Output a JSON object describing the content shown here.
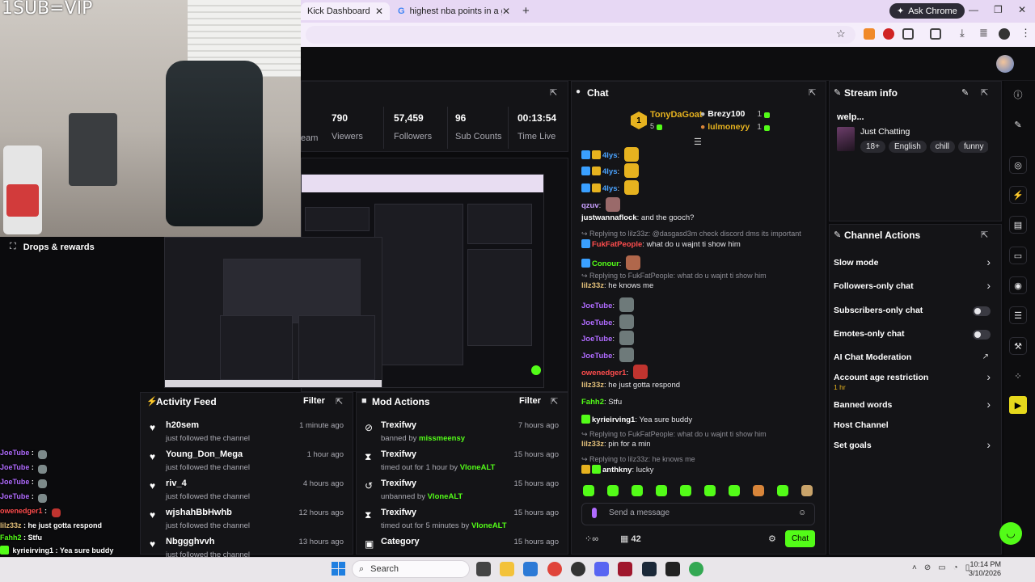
{
  "browser": {
    "tabs": [
      {
        "label": "Kick Dashboard",
        "active": true
      },
      {
        "label": "highest nba points in a game b",
        "active": false
      }
    ],
    "new_tab": "+",
    "ask_chrome": "Ask Chrome",
    "window_controls": [
      "—",
      "❐",
      "✕"
    ]
  },
  "webcam": {
    "overlay_text": "1SUB=VIP"
  },
  "stats": [
    {
      "value": "790",
      "label": "Viewers"
    },
    {
      "value": "57,459",
      "label": "Followers"
    },
    {
      "value": "96",
      "label": "Sub Counts"
    },
    {
      "value": "00:13:54",
      "label": "Time Live"
    }
  ],
  "stats_partial_label": "eam",
  "drops": {
    "label": "Drops & rewards"
  },
  "activity_feed": {
    "title": "Activity Feed",
    "filter": "Filter",
    "items": [
      {
        "name": "h20sem",
        "sub": "just followed the channel",
        "time": "1 minute ago"
      },
      {
        "name": "Young_Don_Mega",
        "sub": "just followed the channel",
        "time": "1 hour ago"
      },
      {
        "name": "riv_4",
        "sub": "just followed the channel",
        "time": "4 hours ago"
      },
      {
        "name": "wjshahBbHwhb",
        "sub": "just followed the channel",
        "time": "12 hours ago"
      },
      {
        "name": "Nbggghvvh",
        "sub": "just followed the channel",
        "time": "13 hours ago"
      }
    ]
  },
  "mod_actions": {
    "title": "Mod Actions",
    "filter": "Filter",
    "items": [
      {
        "name": "Trexifwy",
        "prefix": "banned by ",
        "by": "missmeensy",
        "time": "7 hours ago",
        "icon": "ban-icon"
      },
      {
        "name": "Trexifwy",
        "prefix": "timed out for 1 hour by ",
        "by": "VloneALT",
        "time": "15 hours ago",
        "icon": "hourglass-icon"
      },
      {
        "name": "Trexifwy",
        "prefix": "unbanned by ",
        "by": "VloneALT",
        "time": "15 hours ago",
        "icon": "undo-icon"
      },
      {
        "name": "Trexifwy",
        "prefix": "timed out for 5 minutes by ",
        "by": "VloneALT",
        "time": "15 hours ago",
        "icon": "hourglass-icon"
      },
      {
        "name": "Category",
        "prefix": "",
        "by": "",
        "time": "15 hours ago",
        "icon": "category-icon"
      }
    ]
  },
  "chat": {
    "title": "Chat",
    "top_gifter": {
      "name": "TonyDaGoat",
      "count": "5",
      "rank": "1"
    },
    "gifters": [
      {
        "name": "Brezy100",
        "count": "1"
      },
      {
        "name": "lulmoneyy",
        "count": "1"
      }
    ],
    "messages": [
      {
        "type": "msg",
        "user": "4lys",
        "color": "#4aa3ff",
        "text": ""
      },
      {
        "type": "msg",
        "user": "4lys",
        "color": "#4aa3ff",
        "text": ""
      },
      {
        "type": "msg",
        "user": "4lys",
        "color": "#4aa3ff",
        "text": ""
      },
      {
        "type": "msg",
        "user": "qzuv",
        "color": "#c9a0ff",
        "text": ""
      },
      {
        "type": "msg",
        "user": "justwannaflock",
        "color": "#ffffff",
        "text": "and the gooch?"
      },
      {
        "type": "reply",
        "text": "Replying to lilz33z: @dasgasd3m check discord dms its important"
      },
      {
        "type": "msg",
        "user": "FukFatPeople",
        "color": "#ff4d4d",
        "text": "what do u wajnt ti show him"
      },
      {
        "type": "msg",
        "user": "Conour",
        "color": "#53fc18",
        "text": ""
      },
      {
        "type": "reply",
        "text": "Replying to FukFatPeople: what do u wajnt ti show him"
      },
      {
        "type": "msg",
        "user": "lilz33z",
        "color": "#e3c07a",
        "text": "he knows me"
      },
      {
        "type": "msg",
        "user": "JoeTube",
        "color": "#b06bff",
        "text": ""
      },
      {
        "type": "msg",
        "user": "JoeTube",
        "color": "#b06bff",
        "text": ""
      },
      {
        "type": "msg",
        "user": "JoeTube",
        "color": "#b06bff",
        "text": ""
      },
      {
        "type": "msg",
        "user": "JoeTube",
        "color": "#b06bff",
        "text": ""
      },
      {
        "type": "msg",
        "user": "owenedger1",
        "color": "#ff4d4d",
        "text": ""
      },
      {
        "type": "msg",
        "user": "lilz33z",
        "color": "#e3c07a",
        "text": "he just gotta respond"
      },
      {
        "type": "msg",
        "user": "Fahh2",
        "color": "#53fc18",
        "text": "Stfu"
      },
      {
        "type": "msg",
        "user": "kyrieirving1",
        "color": "#ffffff",
        "text": "Yea sure buddy"
      },
      {
        "type": "reply",
        "text": "Replying to FukFatPeople: what do u wajnt ti show him"
      },
      {
        "type": "msg",
        "user": "lilz33z",
        "color": "#e3c07a",
        "text": "pin for a min"
      },
      {
        "type": "reply",
        "text": "Replying to lilz33z: he knows me"
      },
      {
        "type": "msg",
        "user": "anthkny",
        "color": "#ffffff",
        "text": "lucky"
      }
    ],
    "placeholder": "Send a message",
    "viewer_count": "42",
    "send": "Chat"
  },
  "stream_info": {
    "title": "Stream info",
    "stream_title": "welp...",
    "category": "Just Chatting",
    "tags": [
      "18+",
      "English",
      "chill",
      "funny"
    ]
  },
  "channel_actions": {
    "title": "Channel Actions",
    "items": [
      {
        "label": "Slow mode",
        "control": "chevron"
      },
      {
        "label": "Followers-only chat",
        "control": "chevron"
      },
      {
        "label": "Subscribers-only chat",
        "control": "toggle"
      },
      {
        "label": "Emotes-only chat",
        "control": "toggle"
      },
      {
        "label": "AI Chat Moderation",
        "control": "link"
      },
      {
        "label": "Account age restriction",
        "sub": "1 hr",
        "control": "chevron"
      },
      {
        "label": "Banned words",
        "control": "chevron"
      },
      {
        "label": "Host Channel",
        "control": "none"
      },
      {
        "label": "Set goals",
        "control": "chevron"
      }
    ]
  },
  "overlay_chat": [
    {
      "user": "JoeTube",
      "text": ""
    },
    {
      "user": "JoeTube",
      "text": ""
    },
    {
      "user": "JoeTube",
      "text": ""
    },
    {
      "user": "JoeTube",
      "text": ""
    },
    {
      "user": "owenedger1",
      "text": ""
    },
    {
      "user": "lilz33z",
      "text": "he just gotta respond"
    },
    {
      "user": "Fahh2",
      "text": "Stfu"
    },
    {
      "user": "kyrieirving1",
      "text": "Yea sure buddy"
    }
  ],
  "taskbar": {
    "search": "Search",
    "time": "10:14 PM",
    "date": "3/10/2026"
  },
  "colors": {
    "kick_green": "#53fc18",
    "panel": "#141417",
    "bg": "#0b0b0d"
  }
}
